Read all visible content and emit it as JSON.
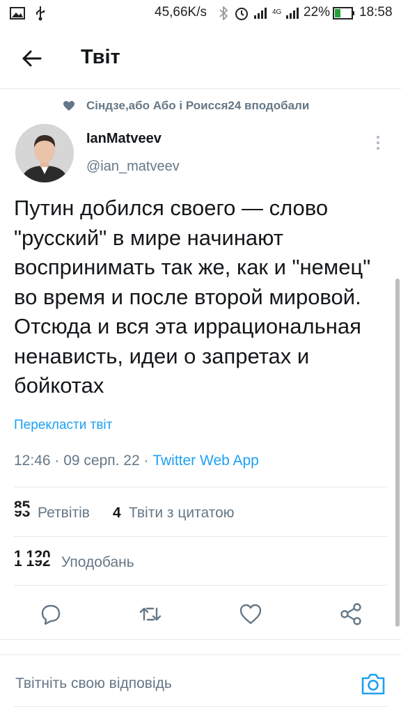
{
  "status_bar": {
    "speed": "45,66K/s",
    "network": "4G",
    "battery": "22%",
    "time": "18:58"
  },
  "header": {
    "title": "Твіт"
  },
  "liked_by": "Сіндзе,або Або і Роисся24 вподобали",
  "author": {
    "name": "IanMatveev",
    "handle": "@ian_matveev"
  },
  "tweet": {
    "text": "Путин добился своего — слово \"русский\" в мире начинают воспринимать так же, как и \"немец\" во время и после второй мировой. Отсюда и вся эта иррациональная ненависть, идеи о запретах и бойкотах",
    "translate_label": "Перекласти твіт",
    "time": "12:46 · 09 серп. 22 · ",
    "source": "Twitter Web App"
  },
  "stats": {
    "retweets_old": "85",
    "retweets": "93",
    "retweets_label": "Ретвітів",
    "quotes": "4",
    "quotes_label": "Твіти з цитатою",
    "likes_old": "1 120",
    "likes": "1 192",
    "likes_label": "Уподобань"
  },
  "actions": [
    "reply",
    "retweet",
    "like",
    "share"
  ],
  "reply_placeholder": "Твітніть свою відповідь",
  "colors": {
    "accent": "#1da1f2",
    "secondary_text": "#657786",
    "divider": "#e1e8ed"
  }
}
